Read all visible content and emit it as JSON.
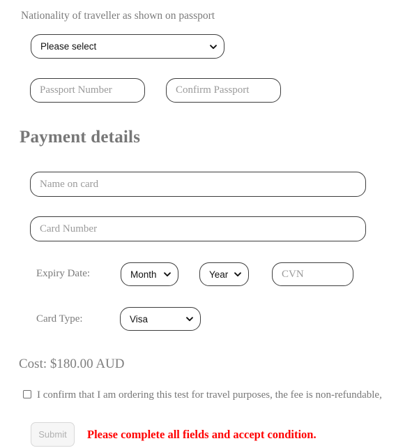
{
  "form": {
    "nationality": {
      "label": "Nationality of traveller as shown on passport",
      "selected": "Please select",
      "options": [
        "Please select"
      ]
    },
    "passport": {
      "number_placeholder": "Passport Number",
      "confirm_placeholder": "Confirm Passport"
    },
    "payment": {
      "heading": "Payment details",
      "name_on_card_placeholder": "Name on card",
      "card_number_placeholder": "Card Number",
      "expiry_label": "Expiry Date:",
      "month_selected": "Month",
      "month_options": [
        "Month"
      ],
      "year_selected": "Year",
      "year_options": [
        "Year"
      ],
      "cvn_placeholder": "CVN",
      "card_type_label": "Card Type:",
      "card_type_selected": "Visa",
      "card_type_options": [
        "Visa"
      ]
    },
    "cost": {
      "text": "Cost: $180.00 AUD",
      "amount": "180.00",
      "currency": "AUD"
    },
    "consent": {
      "text": "I confirm that I am ordering this test for travel purposes, the fee is non-refundable,",
      "checked": false
    },
    "actions": {
      "submit_label": "Submit",
      "submit_disabled": true,
      "error_message": "Please complete all fields and accept condition."
    }
  },
  "colors": {
    "label_gray": "#7b7b7b",
    "heading_gray": "#777777",
    "border_dark": "#3d3d3d",
    "error_red": "#ff0000",
    "submit_bg": "#f6f6f6",
    "submit_text": "#b1b1b1"
  }
}
